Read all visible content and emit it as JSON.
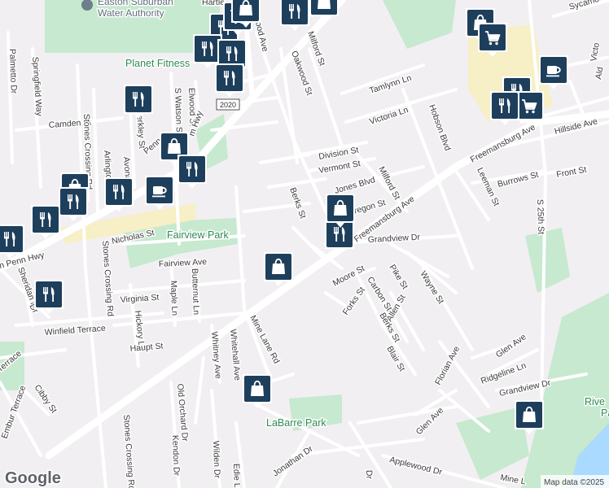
{
  "map": {
    "attribution": "Map data ©2025",
    "logo": "Google",
    "route_shield": "2020",
    "colors": {
      "background": "#f2eff2",
      "park": "#c6e9cf",
      "commercial": "#f7efc5",
      "water": "#aadaff",
      "marker": "#1d3f5c",
      "road": "#ffffff"
    }
  },
  "places": {
    "parks": [
      {
        "id": "fairview",
        "name": "Fairview Park"
      },
      {
        "id": "labarre",
        "name": "LaBarre Park"
      },
      {
        "id": "planet",
        "name": "Planet Fitness"
      },
      {
        "id": "river",
        "name": "Rive\nPa"
      }
    ],
    "poi": [
      {
        "id": "water_authority",
        "name": "Easton Suburban\nWater Authority",
        "icon": "building-icon"
      }
    ]
  },
  "streets": [
    {
      "id": "s1",
      "name": "Palmetto Dr"
    },
    {
      "id": "s2",
      "name": "Springfield Way"
    },
    {
      "id": "s3",
      "name": "Camden St"
    },
    {
      "id": "s4",
      "name": "Stones Crossing Rd"
    },
    {
      "id": "s5",
      "name": "Berkley St"
    },
    {
      "id": "s6",
      "name": "Elwood St"
    },
    {
      "id": "s7",
      "name": "S Watson St"
    },
    {
      "id": "s8",
      "name": "Oakwood St"
    },
    {
      "id": "s9",
      "name": "Milford St"
    },
    {
      "id": "s10",
      "name": "Tamlynn Ln"
    },
    {
      "id": "s11",
      "name": "Victoria Ln"
    },
    {
      "id": "s12",
      "name": "Hobson Blvd"
    },
    {
      "id": "s13",
      "name": "Hillside Ave"
    },
    {
      "id": "s14",
      "name": "Division St"
    },
    {
      "id": "s15",
      "name": "Vermont St"
    },
    {
      "id": "s16",
      "name": "Jones Blvd"
    },
    {
      "id": "s17",
      "name": "Milford St"
    },
    {
      "id": "s18",
      "name": "Burrows St"
    },
    {
      "id": "s19",
      "name": "Front St"
    },
    {
      "id": "s20",
      "name": "Leeman St"
    },
    {
      "id": "s21",
      "name": "S 25th St"
    },
    {
      "id": "s22",
      "name": "Freemansburg Ave"
    },
    {
      "id": "s23",
      "name": "Freemansburg Ave"
    },
    {
      "id": "s24",
      "name": "Berks St"
    },
    {
      "id": "s25",
      "name": "Oregon St"
    },
    {
      "id": "s26",
      "name": "Grandview Dr"
    },
    {
      "id": "s27",
      "name": "Moore St"
    },
    {
      "id": "s28",
      "name": "Pike St"
    },
    {
      "id": "s29",
      "name": "Wayne St"
    },
    {
      "id": "s30",
      "name": "Carbon St"
    },
    {
      "id": "s31",
      "name": "Forks St"
    },
    {
      "id": "s32",
      "name": "Allen St"
    },
    {
      "id": "s33",
      "name": "Berks St"
    },
    {
      "id": "s34",
      "name": "Blair St"
    },
    {
      "id": "s35",
      "name": "Florian Ave"
    },
    {
      "id": "s36",
      "name": "Glen Ave"
    },
    {
      "id": "s37",
      "name": "Ridgeline Ln"
    },
    {
      "id": "s38",
      "name": "Grandview Dr"
    },
    {
      "id": "s39",
      "name": "Glen Ave"
    },
    {
      "id": "s40",
      "name": "Nicholas St"
    },
    {
      "id": "s41",
      "name": "Fairview Ave"
    },
    {
      "id": "s42",
      "name": "Virginia St"
    },
    {
      "id": "s43",
      "name": "Maple Ln"
    },
    {
      "id": "s44",
      "name": "Butternut Ln"
    },
    {
      "id": "s45",
      "name": "Hickory Ln"
    },
    {
      "id": "s46",
      "name": "Haupt St"
    },
    {
      "id": "s47",
      "name": "Winfield Terrace"
    },
    {
      "id": "s48",
      "name": "Sheridan Dr"
    },
    {
      "id": "s49",
      "name": "Terrace"
    },
    {
      "id": "s50",
      "name": "Embur Terrace"
    },
    {
      "id": "s51",
      "name": "Cibby St"
    },
    {
      "id": "s52",
      "name": "Mine Lane Rd"
    },
    {
      "id": "s53",
      "name": "Whitehall Ave"
    },
    {
      "id": "s54",
      "name": "Whitney Ave"
    },
    {
      "id": "s55",
      "name": "Old Orchard Dr"
    },
    {
      "id": "s56",
      "name": "Kendon Dr"
    },
    {
      "id": "s57",
      "name": "Wilden Dr"
    },
    {
      "id": "s58",
      "name": "Stones Crossing Rd"
    },
    {
      "id": "s59",
      "name": "Edie Ln"
    },
    {
      "id": "s60",
      "name": "Jonathan Dr"
    },
    {
      "id": "s61",
      "name": "Applewood Dr"
    },
    {
      "id": "s62",
      "name": "Mine L"
    },
    {
      "id": "s63",
      "name": "Sycamo"
    },
    {
      "id": "s64",
      "name": "Victo"
    },
    {
      "id": "s65",
      "name": "Ald"
    },
    {
      "id": "s66",
      "name": "n Penn Hwy"
    },
    {
      "id": "s67",
      "name": "Hartle"
    },
    {
      "id": "s68",
      "name": "wood Ave"
    },
    {
      "id": "s69",
      "name": "Arlington St"
    },
    {
      "id": "s70",
      "name": "Avona"
    },
    {
      "id": "s71",
      "name": "m Hwy"
    },
    {
      "id": "s72",
      "name": "Stones Crossing Rd"
    },
    {
      "id": "s73",
      "name": "Penn"
    },
    {
      "id": "s74",
      "name": "Dr"
    },
    {
      "id": "s75",
      "name": "Dr"
    }
  ],
  "markers": [
    {
      "id": "m1",
      "type": "coffee",
      "icon": "coffee-cup-icon"
    },
    {
      "id": "m2",
      "type": "restaurant",
      "icon": "fork-knife-icon"
    },
    {
      "id": "m3",
      "type": "shopping",
      "icon": "shopping-cart-icon"
    },
    {
      "id": "m4",
      "type": "shopping",
      "icon": "shopping-bag-icon"
    },
    {
      "id": "m5",
      "type": "shopping",
      "icon": "shopping-cart-icon"
    },
    {
      "id": "m6",
      "type": "restaurant",
      "icon": "fork-knife-icon"
    },
    {
      "id": "m7",
      "type": "shopping",
      "icon": "shopping-cart-icon"
    },
    {
      "id": "m8",
      "type": "restaurant",
      "icon": "fork-knife-icon"
    },
    {
      "id": "m9",
      "type": "restaurant",
      "icon": "fork-knife-icon"
    },
    {
      "id": "m10",
      "type": "restaurant",
      "icon": "fork-knife-icon"
    },
    {
      "id": "m11",
      "type": "restaurant",
      "icon": "fork-knife-icon"
    },
    {
      "id": "m12",
      "type": "coffee",
      "icon": "coffee-cup-icon"
    },
    {
      "id": "m13",
      "type": "restaurant",
      "icon": "fork-knife-icon"
    },
    {
      "id": "m14",
      "type": "shopping",
      "icon": "shopping-cart-icon"
    },
    {
      "id": "m15",
      "type": "restaurant",
      "icon": "fork-knife-icon"
    },
    {
      "id": "m16",
      "type": "shopping",
      "icon": "shopping-bag-icon"
    },
    {
      "id": "m17",
      "type": "restaurant",
      "icon": "fork-knife-icon"
    },
    {
      "id": "m18",
      "type": "coffee",
      "icon": "coffee-cup-icon"
    },
    {
      "id": "m19",
      "type": "restaurant",
      "icon": "fork-knife-icon"
    },
    {
      "id": "m20",
      "type": "shopping",
      "icon": "shopping-bag-icon"
    },
    {
      "id": "m21",
      "type": "restaurant",
      "icon": "fork-knife-icon"
    },
    {
      "id": "m22",
      "type": "restaurant",
      "icon": "fork-knife-icon"
    },
    {
      "id": "m23",
      "type": "restaurant",
      "icon": "fork-knife-icon"
    },
    {
      "id": "m24",
      "type": "restaurant",
      "icon": "fork-knife-icon"
    },
    {
      "id": "m25",
      "type": "shopping",
      "icon": "shopping-bag-icon"
    },
    {
      "id": "m26",
      "type": "restaurant",
      "icon": "fork-knife-icon"
    },
    {
      "id": "m27",
      "type": "shopping",
      "icon": "shopping-bag-icon"
    },
    {
      "id": "m28",
      "type": "shopping",
      "icon": "shopping-bag-icon"
    },
    {
      "id": "m29",
      "type": "shopping",
      "icon": "shopping-bag-icon"
    },
    {
      "id": "m30",
      "type": "restaurant",
      "icon": "fork-knife-icon"
    },
    {
      "id": "m31",
      "type": "shopping",
      "icon": "shopping-bag-icon"
    },
    {
      "id": "m32",
      "type": "shopping",
      "icon": "shopping-bag-icon"
    }
  ]
}
